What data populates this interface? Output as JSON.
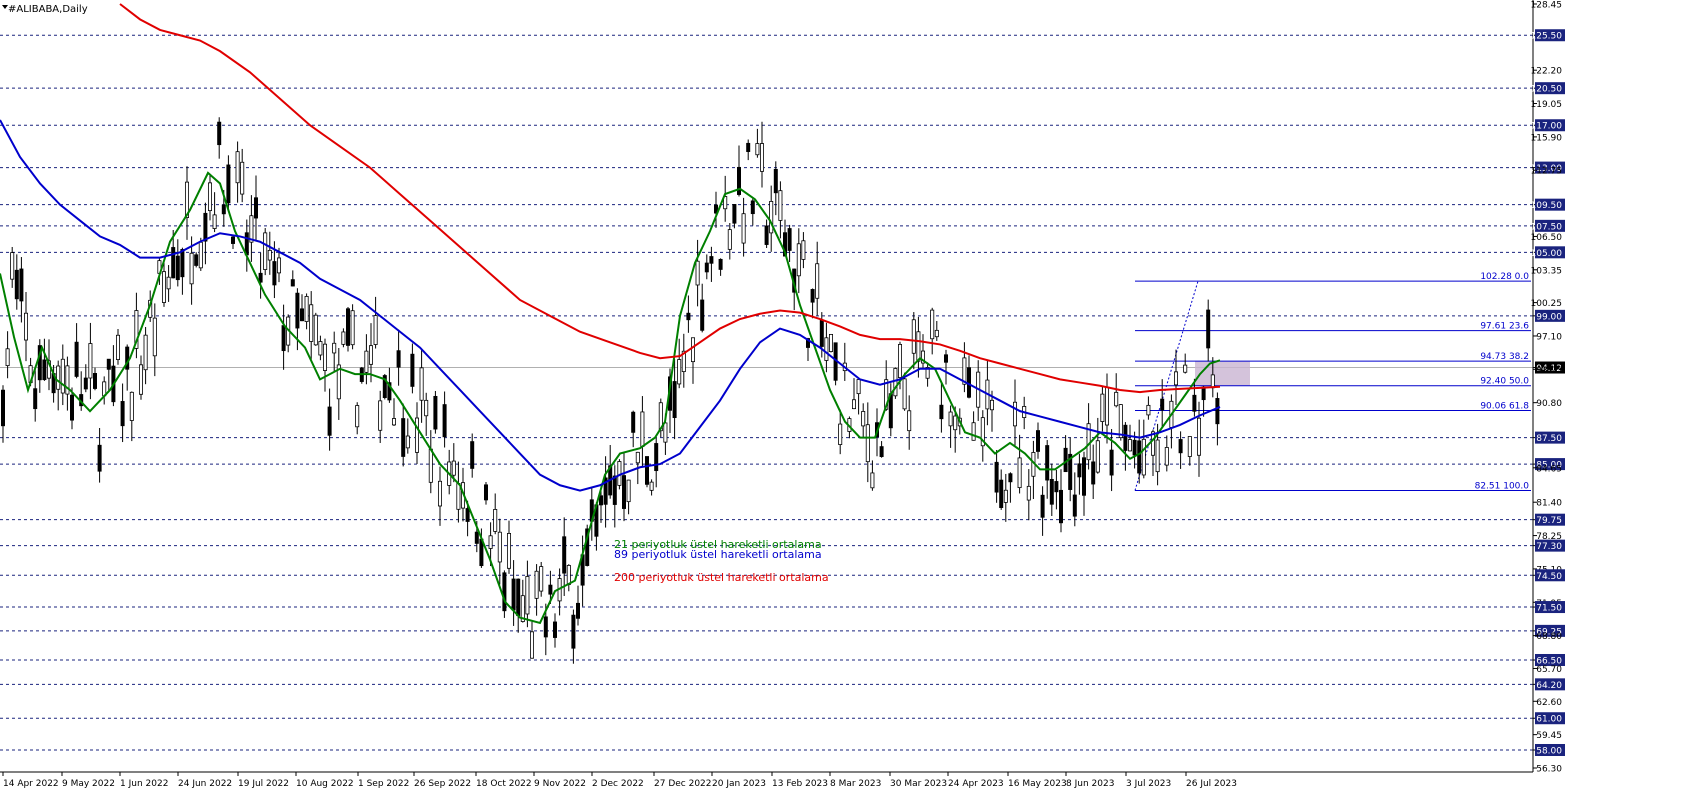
{
  "window": {
    "title": "#ALIBABA,Daily"
  },
  "chart_data": {
    "type": "candlestick",
    "symbol": "#ALIBABA",
    "timeframe": "Daily",
    "ylim": [
      56.3,
      128.45
    ],
    "y_ticks": [
      "128.45",
      "125.50",
      "122.20",
      "120.50",
      "119.05",
      "117.00",
      "115.90",
      "113.00",
      "112.75",
      "109.50",
      "107.50",
      "106.50",
      "105.00",
      "103.35",
      "100.25",
      "99.00",
      "97.10",
      "94.12",
      "93.95",
      "90.80",
      "87.50",
      "85.00",
      "84.65",
      "81.40",
      "79.75",
      "78.25",
      "77.30",
      "75.10",
      "74.50",
      "71.95",
      "71.50",
      "69.25",
      "68.80",
      "66.50",
      "65.70",
      "64.20",
      "62.60",
      "61.00",
      "59.45",
      "58.00",
      "56.30"
    ],
    "highlighted_levels": [
      125.5,
      120.5,
      117.0,
      113.0,
      109.5,
      107.5,
      105.0,
      99.0,
      87.5,
      85.0,
      79.75,
      77.3,
      74.5,
      71.5,
      69.25,
      66.5,
      64.2,
      61.0,
      58.0
    ],
    "current_price": "94.12",
    "x_labels": [
      "14 Apr 2022",
      "9 May 2022",
      "1 Jun 2022",
      "24 Jun 2022",
      "19 Jul 2022",
      "10 Aug 2022",
      "1 Sep 2022",
      "26 Sep 2022",
      "18 Oct 2022",
      "9 Nov 2022",
      "2 Dec 2022",
      "27 Dec 2022",
      "20 Jan 2023",
      "13 Feb 2023",
      "8 Mar 2023",
      "30 Mar 2023",
      "24 Apr 2023",
      "16 May 2023",
      "8 Jun 2023",
      "3 Jul 2023",
      "26 Jul 2023"
    ],
    "fibonacci": [
      {
        "label": "102.28 0.0",
        "price": 102.28
      },
      {
        "label": "97.61 23.6",
        "price": 97.61
      },
      {
        "label": "94.73 38.2",
        "price": 94.73
      },
      {
        "label": "92.40 50.0",
        "price": 92.4
      },
      {
        "label": "90.06 61.8",
        "price": 90.06
      },
      {
        "label": "82.51 100.0",
        "price": 82.51
      }
    ],
    "series": [
      {
        "name": "21 periyotluk üstel hareketli ortalama",
        "color": "#008000",
        "points": [
          [
            0,
            103
          ],
          [
            14,
            97
          ],
          [
            28,
            92
          ],
          [
            42,
            96
          ],
          [
            56,
            93
          ],
          [
            70,
            92
          ],
          [
            90,
            90
          ],
          [
            110,
            92
          ],
          [
            130,
            95
          ],
          [
            150,
            100
          ],
          [
            170,
            106
          ],
          [
            190,
            109
          ],
          [
            208,
            112.5
          ],
          [
            220,
            111.5
          ],
          [
            235,
            107
          ],
          [
            250,
            104
          ],
          [
            265,
            101
          ],
          [
            285,
            98
          ],
          [
            305,
            96
          ],
          [
            320,
            93
          ],
          [
            340,
            94
          ],
          [
            355,
            93.5
          ],
          [
            370,
            93.5
          ],
          [
            385,
            93
          ],
          [
            400,
            91
          ],
          [
            420,
            88
          ],
          [
            440,
            85
          ],
          [
            460,
            83
          ],
          [
            475,
            79.5
          ],
          [
            490,
            76
          ],
          [
            505,
            72
          ],
          [
            520,
            70.5
          ],
          [
            540,
            70
          ],
          [
            555,
            73
          ],
          [
            575,
            74
          ],
          [
            590,
            79
          ],
          [
            605,
            84
          ],
          [
            620,
            86
          ],
          [
            640,
            86.5
          ],
          [
            655,
            87.5
          ],
          [
            665,
            89
          ],
          [
            680,
            99
          ],
          [
            695,
            104
          ],
          [
            710,
            107
          ],
          [
            725,
            110.5
          ],
          [
            740,
            111
          ],
          [
            755,
            110
          ],
          [
            770,
            108
          ],
          [
            785,
            105
          ],
          [
            800,
            100
          ],
          [
            815,
            96
          ],
          [
            830,
            92
          ],
          [
            845,
            89
          ],
          [
            860,
            87.5
          ],
          [
            875,
            87.5
          ],
          [
            890,
            91.5
          ],
          [
            905,
            93.5
          ],
          [
            920,
            95
          ],
          [
            935,
            94
          ],
          [
            950,
            91
          ],
          [
            965,
            88
          ],
          [
            980,
            87.5
          ],
          [
            995,
            86
          ],
          [
            1010,
            87
          ],
          [
            1025,
            86
          ],
          [
            1040,
            84.5
          ],
          [
            1055,
            84.5
          ],
          [
            1070,
            85.5
          ],
          [
            1085,
            86.5
          ],
          [
            1100,
            88
          ],
          [
            1115,
            87
          ],
          [
            1130,
            85.5
          ],
          [
            1140,
            86
          ],
          [
            1155,
            87.5
          ],
          [
            1170,
            89.5
          ],
          [
            1185,
            91.5
          ],
          [
            1200,
            93.5
          ],
          [
            1210,
            94.5
          ],
          [
            1220,
            94.8
          ]
        ]
      },
      {
        "name": "89 periyotluk üstel hareketli ortalama",
        "color": "#0000cc",
        "points": [
          [
            0,
            117.5
          ],
          [
            20,
            114
          ],
          [
            40,
            111.5
          ],
          [
            60,
            109.5
          ],
          [
            80,
            108
          ],
          [
            100,
            106.5
          ],
          [
            120,
            105.7
          ],
          [
            140,
            104.5
          ],
          [
            160,
            104.5
          ],
          [
            180,
            105
          ],
          [
            200,
            106
          ],
          [
            220,
            106.8
          ],
          [
            240,
            106.5
          ],
          [
            260,
            106
          ],
          [
            280,
            105
          ],
          [
            300,
            104
          ],
          [
            320,
            102.5
          ],
          [
            340,
            101.5
          ],
          [
            360,
            100.5
          ],
          [
            380,
            99
          ],
          [
            400,
            97.5
          ],
          [
            420,
            96
          ],
          [
            440,
            94
          ],
          [
            460,
            92
          ],
          [
            480,
            90
          ],
          [
            500,
            88
          ],
          [
            520,
            86
          ],
          [
            540,
            84
          ],
          [
            560,
            83
          ],
          [
            580,
            82.5
          ],
          [
            600,
            83
          ],
          [
            620,
            84
          ],
          [
            640,
            84.7
          ],
          [
            660,
            85
          ],
          [
            680,
            86
          ],
          [
            700,
            88.5
          ],
          [
            720,
            91
          ],
          [
            740,
            94
          ],
          [
            760,
            96.5
          ],
          [
            780,
            97.8
          ],
          [
            800,
            97.2
          ],
          [
            820,
            96
          ],
          [
            840,
            94.5
          ],
          [
            860,
            93
          ],
          [
            880,
            92.5
          ],
          [
            900,
            93
          ],
          [
            920,
            94
          ],
          [
            940,
            94
          ],
          [
            960,
            93
          ],
          [
            980,
            92
          ],
          [
            1000,
            91
          ],
          [
            1020,
            90
          ],
          [
            1040,
            89.5
          ],
          [
            1060,
            89
          ],
          [
            1080,
            88.5
          ],
          [
            1100,
            88
          ],
          [
            1120,
            87.8
          ],
          [
            1140,
            87.5
          ],
          [
            1160,
            88
          ],
          [
            1180,
            88.7
          ],
          [
            1200,
            89.6
          ],
          [
            1220,
            90.4
          ]
        ]
      },
      {
        "name": "200 periyotluk üstel hareketli ortalama",
        "color": "#e00000",
        "points": [
          [
            120,
            128.45
          ],
          [
            140,
            127
          ],
          [
            160,
            126
          ],
          [
            180,
            125.5
          ],
          [
            200,
            125
          ],
          [
            220,
            124
          ],
          [
            250,
            122
          ],
          [
            280,
            119.5
          ],
          [
            310,
            117
          ],
          [
            340,
            115
          ],
          [
            370,
            113
          ],
          [
            400,
            110.5
          ],
          [
            430,
            108
          ],
          [
            460,
            105.5
          ],
          [
            490,
            103
          ],
          [
            520,
            100.5
          ],
          [
            550,
            99
          ],
          [
            580,
            97.5
          ],
          [
            610,
            96.5
          ],
          [
            640,
            95.5
          ],
          [
            660,
            95
          ],
          [
            680,
            95.2
          ],
          [
            700,
            96.5
          ],
          [
            720,
            97.8
          ],
          [
            740,
            98.7
          ],
          [
            760,
            99.2
          ],
          [
            780,
            99.5
          ],
          [
            800,
            99.3
          ],
          [
            820,
            98.7
          ],
          [
            840,
            98
          ],
          [
            860,
            97.2
          ],
          [
            880,
            96.8
          ],
          [
            900,
            96.8
          ],
          [
            920,
            96.6
          ],
          [
            940,
            96.3
          ],
          [
            960,
            95.7
          ],
          [
            980,
            95
          ],
          [
            1000,
            94.5
          ],
          [
            1020,
            94
          ],
          [
            1040,
            93.5
          ],
          [
            1060,
            93
          ],
          [
            1080,
            92.7
          ],
          [
            1100,
            92.4
          ],
          [
            1120,
            92
          ],
          [
            1140,
            91.8
          ],
          [
            1160,
            92
          ],
          [
            1180,
            92.1
          ],
          [
            1200,
            92.2
          ],
          [
            1220,
            92.3
          ]
        ]
      }
    ],
    "annotations": [
      {
        "text": "21 periyotluk üstel hareketli ortalama",
        "color": "#008000"
      },
      {
        "text": "89 periyotluk üstel hareketli ortalama",
        "color": "#0000cc"
      },
      {
        "text": "200 periyotluk üstel hareketli ortalama",
        "color": "#e00000"
      }
    ]
  }
}
